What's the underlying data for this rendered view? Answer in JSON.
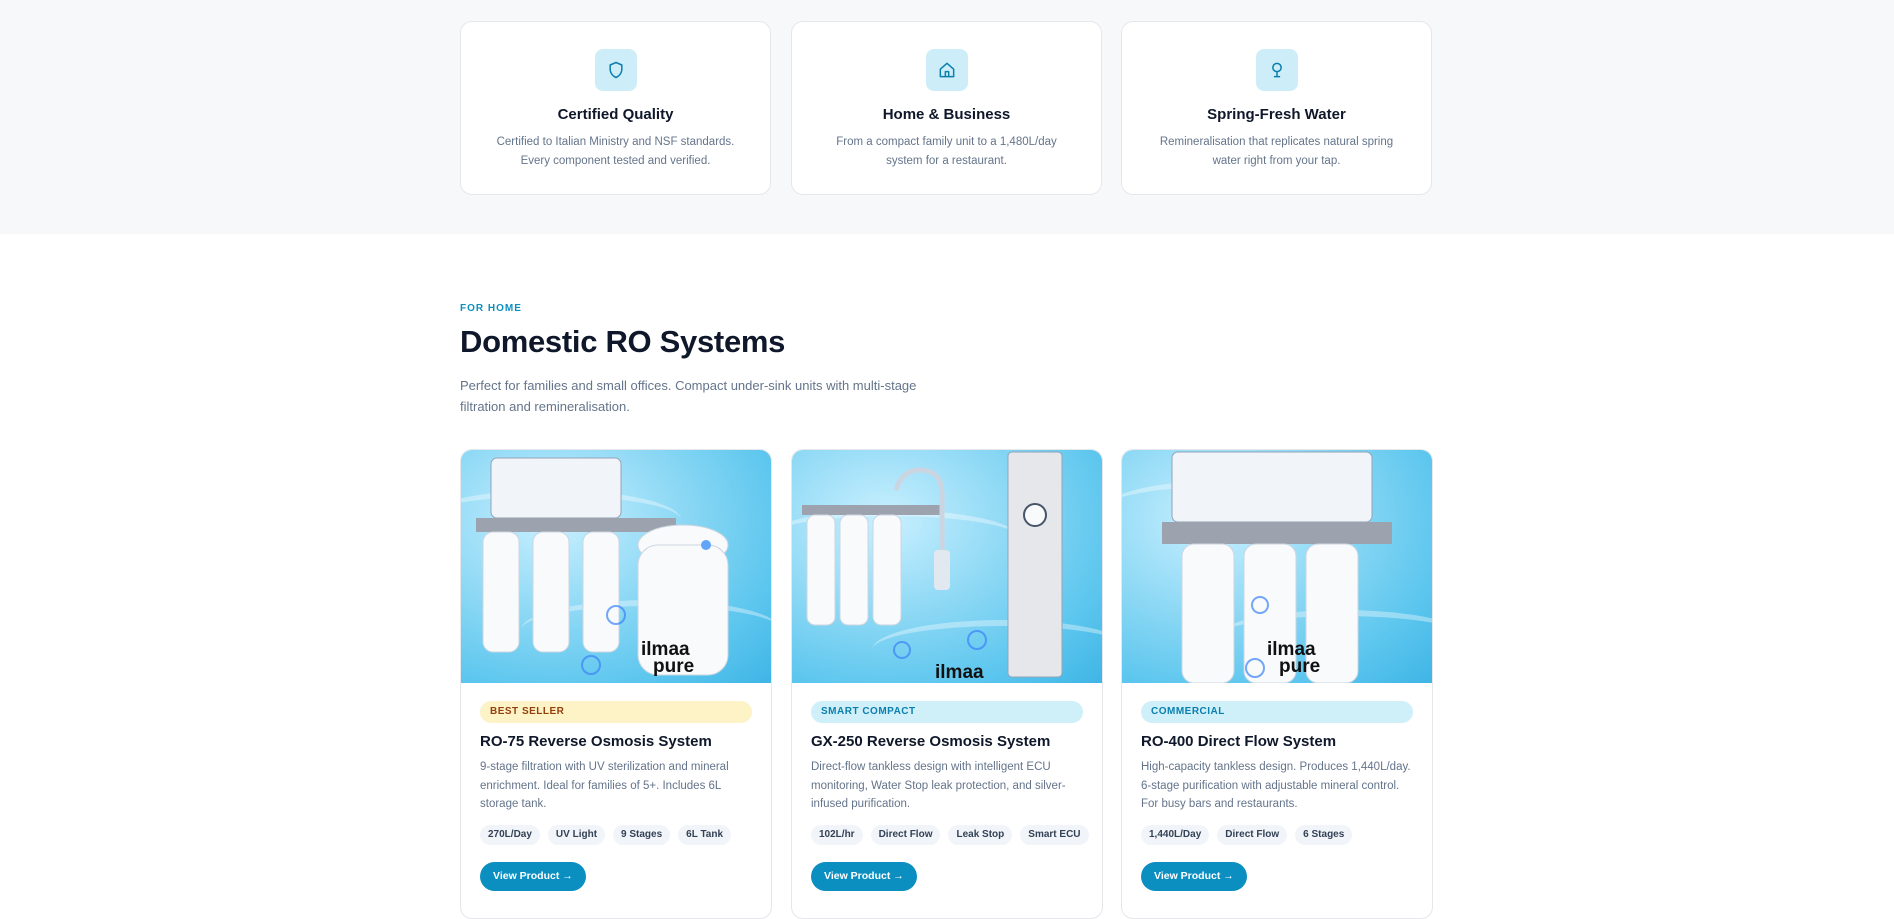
{
  "features": [
    {
      "icon": "shield-icon",
      "title": "Certified Quality",
      "description": "Certified to Italian Ministry and NSF standards. Every component tested and verified."
    },
    {
      "icon": "home-icon",
      "title": "Home & Business",
      "description": "From a compact family unit to a 1,480L/day system for a restaurant."
    },
    {
      "icon": "lightbulb-icon",
      "title": "Spring-Fresh Water",
      "description": "Remineralisation that replicates natural spring water right from your tap."
    }
  ],
  "section": {
    "eyebrow": "FOR HOME",
    "title": "Domestic RO Systems",
    "description": "Perfect for families and small offices. Compact under-sink units with multi-stage filtration and remineralisation."
  },
  "products": [
    {
      "badge": "BEST SELLER",
      "badge_bg": "#fef3c7",
      "badge_color": "#92400e",
      "title": "RO-75 Reverse Osmosis System",
      "description": "9-stage filtration with UV sterilization and mineral enrichment. Ideal for families of 5+. Includes 6L storage tank.",
      "tags": [
        "270L/Day",
        "UV Light",
        "9 Stages",
        "6L Tank"
      ],
      "cta": "View Product →",
      "brand_line1": "ilmaa",
      "brand_line2": "pure"
    },
    {
      "badge": "SMART COMPACT",
      "badge_bg": "#cff0f9",
      "badge_color": "#0b7fae",
      "title": "GX-250 Reverse Osmosis System",
      "description": "Direct-flow tankless design with intelligent ECU monitoring, Water Stop leak protection, and silver-infused purification.",
      "tags": [
        "102L/hr",
        "Direct Flow",
        "Leak Stop",
        "Smart ECU"
      ],
      "cta": "View Product →",
      "brand_line1": "ilmaa",
      "brand_line2": ""
    },
    {
      "badge": "COMMERCIAL",
      "badge_bg": "#cff0f9",
      "badge_color": "#0b7fae",
      "title": "RO-400 Direct Flow System",
      "description": "High-capacity tankless design. Produces 1,440L/day. 6-stage purification with adjustable mineral control. For busy bars and restaurants.",
      "tags": [
        "1,440L/Day",
        "Direct Flow",
        "6 Stages"
      ],
      "cta": "View Product →",
      "brand_line1": "ilmaa",
      "brand_line2": "pure"
    }
  ],
  "colors": {
    "accent": "#0b8fc1",
    "icon_bg": "#cdeef8",
    "band_bg": "#f7f8fa"
  }
}
